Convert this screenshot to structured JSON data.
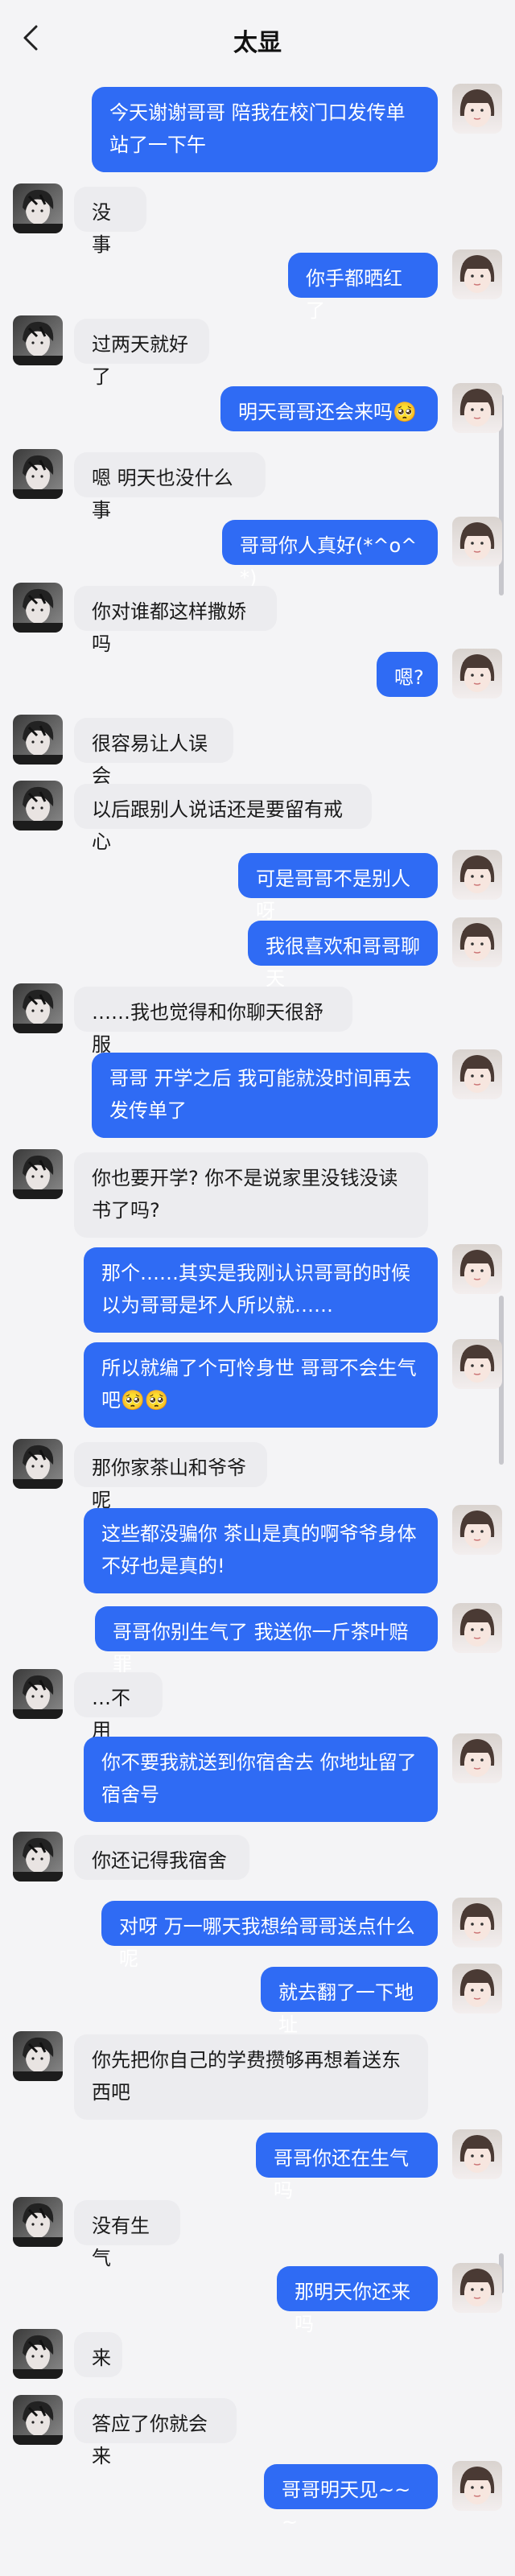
{
  "header": {
    "title": "太显"
  },
  "colors": {
    "outgoing_bubble": "#2f6bf4",
    "incoming_bubble": "#ececef",
    "background": "#f4f4f6"
  },
  "messages": [
    {
      "from": "me",
      "text": "今天谢谢哥哥 陪我在校门口发传单站了一下午"
    },
    {
      "from": "them",
      "text": "没事"
    },
    {
      "from": "me",
      "text": "你手都晒红了"
    },
    {
      "from": "them",
      "text": "过两天就好了"
    },
    {
      "from": "me",
      "text": "明天哥哥还会来吗🥺"
    },
    {
      "from": "them",
      "text": "嗯 明天也没什么事"
    },
    {
      "from": "me",
      "text": "哥哥你人真好(*^o^*)"
    },
    {
      "from": "them",
      "text": "你对谁都这样撒娇吗"
    },
    {
      "from": "me",
      "text": "嗯?"
    },
    {
      "from": "them",
      "text": "很容易让人误会"
    },
    {
      "from": "them",
      "text": "以后跟别人说话还是要留有戒心"
    },
    {
      "from": "me",
      "text": "可是哥哥不是别人呀"
    },
    {
      "from": "me",
      "text": "我很喜欢和哥哥聊天"
    },
    {
      "from": "them",
      "text": "……我也觉得和你聊天很舒服"
    },
    {
      "from": "me",
      "text": "哥哥 开学之后 我可能就没时间再去发传单了"
    },
    {
      "from": "them",
      "text": "你也要开学? 你不是说家里没钱没读书了吗?"
    },
    {
      "from": "me",
      "text": "那个……其实是我刚认识哥哥的时候 以为哥哥是坏人所以就……"
    },
    {
      "from": "me",
      "text": "所以就编了个可怜身世 哥哥不会生气吧🥺🥺"
    },
    {
      "from": "them",
      "text": "那你家茶山和爷爷呢"
    },
    {
      "from": "me",
      "text": "这些都没骗你 茶山是真的啊爷爷身体不好也是真的!"
    },
    {
      "from": "me",
      "text": "哥哥你别生气了 我送你一斤茶叶赔罪"
    },
    {
      "from": "them",
      "text": "…不用"
    },
    {
      "from": "me",
      "text": "你不要我就送到你宿舍去 你地址留了宿舍号"
    },
    {
      "from": "them",
      "text": "你还记得我宿舍"
    },
    {
      "from": "me",
      "text": "对呀 万一哪天我想给哥哥送点什么呢"
    },
    {
      "from": "me",
      "text": "就去翻了一下地址"
    },
    {
      "from": "them",
      "text": "你先把你自己的学费攒够再想着送东西吧"
    },
    {
      "from": "me",
      "text": "哥哥你还在生气吗"
    },
    {
      "from": "them",
      "text": "没有生气"
    },
    {
      "from": "me",
      "text": "那明天你还来吗"
    },
    {
      "from": "them",
      "text": "来"
    },
    {
      "from": "them",
      "text": "答应了你就会来"
    },
    {
      "from": "me",
      "text": "哥哥明天见~~~"
    }
  ]
}
